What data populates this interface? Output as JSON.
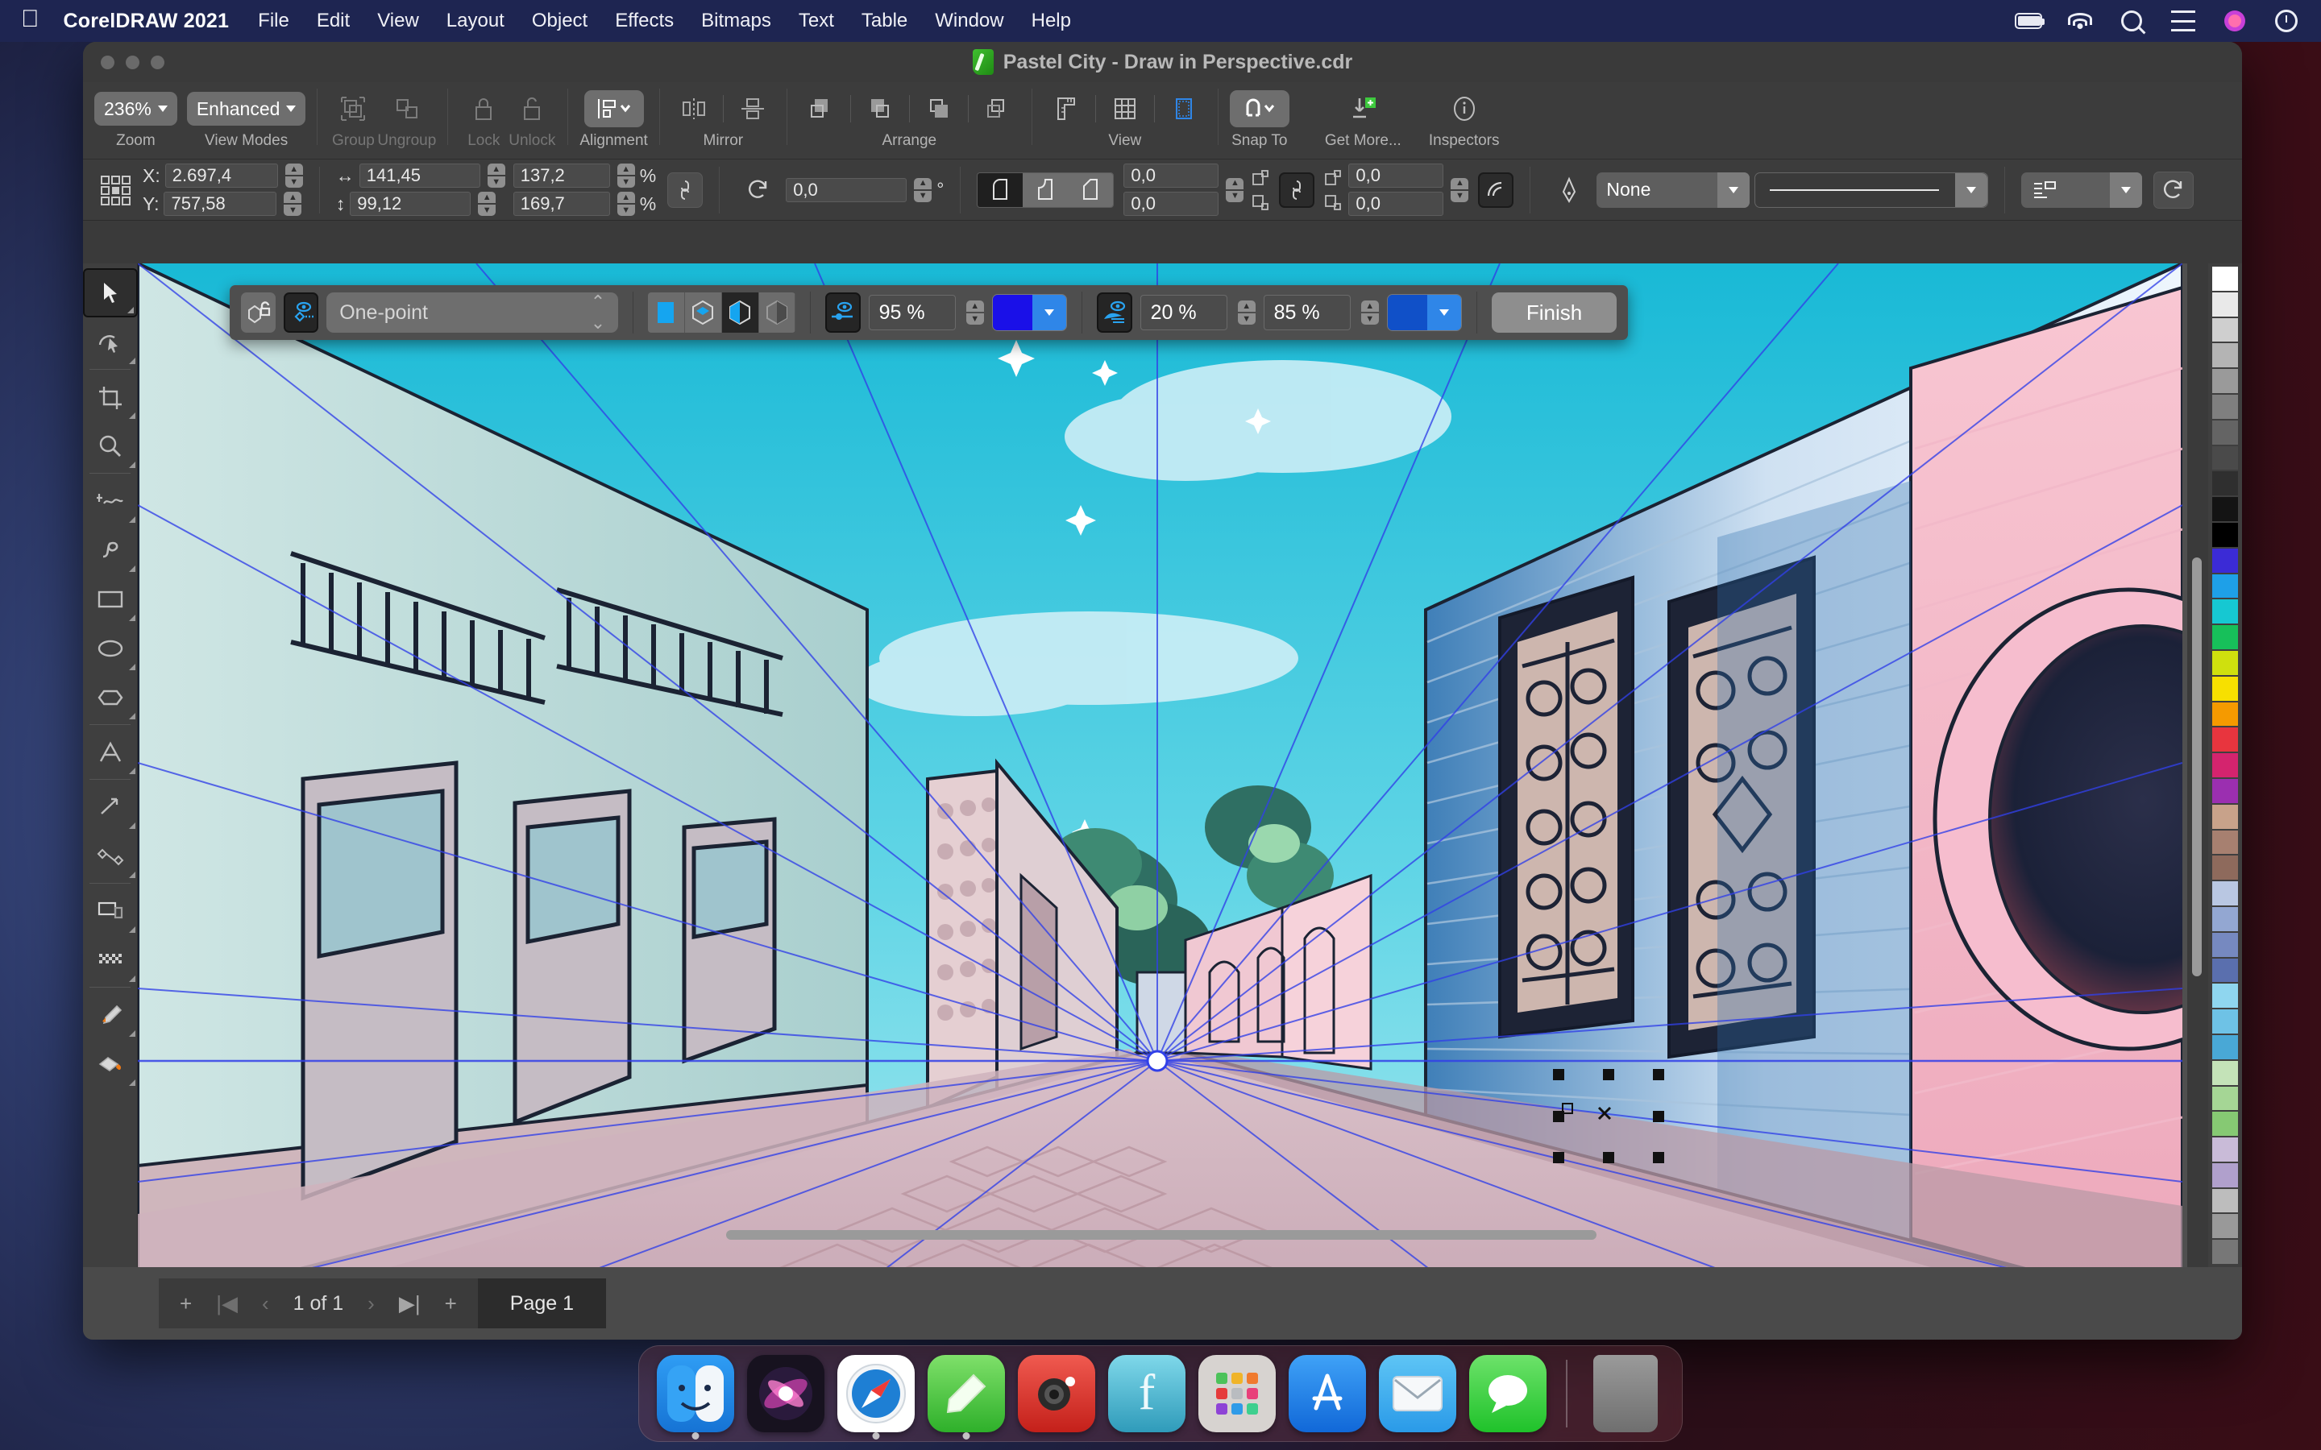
{
  "menubar": {
    "apple_glyph": "apple-logo",
    "app_name": "CorelDRAW 2021",
    "items": [
      "File",
      "Edit",
      "View",
      "Layout",
      "Object",
      "Effects",
      "Bitmaps",
      "Text",
      "Table",
      "Window",
      "Help"
    ],
    "status_icons": [
      "battery-icon",
      "wifi-icon",
      "search-icon",
      "control-center-icon",
      "siri-icon",
      "time-machine-icon"
    ]
  },
  "window": {
    "title": "Pastel City - Draw in Perspective.cdr",
    "traffic_lights": [
      "close-button",
      "minimize-button",
      "zoom-button"
    ]
  },
  "toolbar": {
    "groups": [
      {
        "label": "Zoom",
        "value": "236%",
        "type": "dropdown"
      },
      {
        "label": "View Modes",
        "value": "Enhanced",
        "type": "dropdown"
      },
      {
        "label": "Group",
        "icon": "group-icon",
        "disabled": true
      },
      {
        "label": "Ungroup",
        "icon": "ungroup-icon",
        "disabled": true
      },
      {
        "label": "Lock",
        "icon": "lock-icon",
        "disabled": true
      },
      {
        "label": "Unlock",
        "icon": "unlock-icon",
        "disabled": true
      },
      {
        "label": "Alignment",
        "icon": "align-icon",
        "active": true
      },
      {
        "label": "Mirror",
        "icon": "mirror-icon"
      },
      {
        "label": "Arrange",
        "icon": "arrange-icon"
      },
      {
        "label": "View",
        "icon": "grid-icon"
      },
      {
        "label": "Snap To",
        "icon": "magnet-icon",
        "active": true
      },
      {
        "label": "Get More...",
        "icon": "download-plus-icon"
      },
      {
        "label": "Inspectors",
        "icon": "info-icon"
      }
    ]
  },
  "propertybar": {
    "x_label": "X:",
    "x_value": "2.697,4",
    "y_label": "Y:",
    "y_value": "757,58",
    "width_value": "141,45",
    "height_value": "99,12",
    "scale_x": "137,2",
    "scale_y": "169,7",
    "percent_symbol": "%",
    "rotation_value": "0,0",
    "degree_symbol": "°",
    "outline_corner_a": "0,0",
    "outline_corner_b": "0,0",
    "wrap_a": "0,0",
    "wrap_b": "0,0",
    "outline_width": "None",
    "icons": [
      "object-origin-icon",
      "width-arrow-icon",
      "height-arrow-icon",
      "lock-ratio-icon",
      "rotate-icon",
      "mirror-h-icon",
      "mirror-v-icon",
      "corner-round-icon",
      "corner-scallop-icon",
      "corner-chamfer-icon",
      "link-corners-icon",
      "wrap-text-icon",
      "pen-icon",
      "outline-style-icon",
      "text-props-icon",
      "refresh-icon"
    ]
  },
  "perspectivebar": {
    "lock_icon": "perspective-lock-icon",
    "show_field_icon": "show-perspective-field-icon",
    "type": "One-point",
    "plane_buttons": [
      "plane-flat-icon",
      "plane-ortho-icon",
      "plane-left-icon",
      "plane-right-icon"
    ],
    "opacity_icon": "opacity-slider-icon",
    "opacity_value": "95 %",
    "line_color": "#1a10e8",
    "fade_icon": "fade-lines-icon",
    "fade_value": "20 %",
    "fade2_value": "85 %",
    "fade_color": "#1050c8",
    "finish_label": "Finish"
  },
  "toolbox": {
    "tools": [
      {
        "name": "pick-tool",
        "selected": true
      },
      {
        "name": "shape-tool"
      },
      {
        "name": "crop-tool"
      },
      {
        "name": "zoom-tool"
      },
      {
        "name": "freehand-tool"
      },
      {
        "name": "artistic-media-tool"
      },
      {
        "name": "rectangle-tool"
      },
      {
        "name": "ellipse-tool"
      },
      {
        "name": "polygon-tool"
      },
      {
        "name": "text-tool"
      },
      {
        "name": "dimension-tool"
      },
      {
        "name": "connector-tool"
      },
      {
        "name": "drop-shadow-tool"
      },
      {
        "name": "transparency-tool"
      },
      {
        "name": "color-eyedropper-tool"
      },
      {
        "name": "interactive-fill-tool"
      }
    ]
  },
  "statusbar": {
    "add_page_left": "+",
    "first_label": "first-page",
    "prev_label": "prev-page",
    "page_counter": "1 of 1",
    "next_label": "next-page",
    "last_label": "last-page",
    "add_page_right": "+",
    "page_tab": "Page 1"
  },
  "palette": {
    "colors": [
      "#ffffff",
      "#e9e9e9",
      "#cfcfcf",
      "#b4b4b4",
      "#9a9a9a",
      "#7f7f7f",
      "#646464",
      "#4a4a4a",
      "#2f2f2f",
      "#141414",
      "#000000",
      "#3b2bd6",
      "#1ea0e8",
      "#16c8d2",
      "#17c05a",
      "#cfe00e",
      "#f7e000",
      "#f59a00",
      "#e8353e",
      "#d4246e",
      "#9b2fb0",
      "#c8a28a",
      "#a78070",
      "#8e6a5c",
      "#b9c7e2",
      "#93a7d2",
      "#7689c0",
      "#5a6fae",
      "#8fd6ef",
      "#6ec2e6",
      "#49a8d6",
      "#c4e3b8",
      "#a5d695",
      "#86c973",
      "#c9bbd8",
      "#b0a0cc",
      "#bdbdbd",
      "#999999",
      "#777777"
    ]
  },
  "dock": {
    "apps": [
      {
        "name": "finder-icon",
        "running": true
      },
      {
        "name": "siri-icon",
        "running": false
      },
      {
        "name": "safari-icon",
        "running": true
      },
      {
        "name": "notes-icon",
        "running": true
      },
      {
        "name": "photobooth-icon",
        "running": false
      },
      {
        "name": "fontbook-icon",
        "running": false
      },
      {
        "name": "launchpad-icon",
        "running": false
      },
      {
        "name": "appstore-icon",
        "running": false
      },
      {
        "name": "mail-icon",
        "running": false
      },
      {
        "name": "messages-icon",
        "running": false
      }
    ],
    "trash": "trash-icon"
  },
  "canvas": {
    "document_name": "Pastel City - Draw in Perspective",
    "perspective_mode": "One-point",
    "vanishing_point_label": "vanishing-point",
    "selection_handles": 8,
    "description": "Pastel-colored one-point perspective city alley illustration with perspective guide lines converging at a vanishing point"
  }
}
